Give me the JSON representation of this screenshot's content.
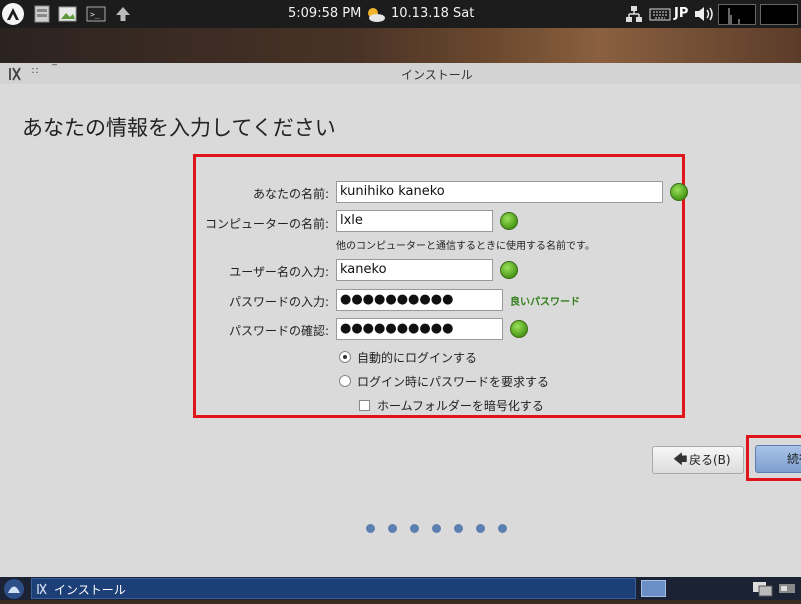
{
  "top_panel": {
    "clock": "5:09:58 PM",
    "date": "10.13.18 Sat",
    "keyboard_layout": "JP",
    "icons": [
      "lxle-menu-icon",
      "file-manager-icon",
      "image-viewer-icon",
      "terminal-icon",
      "updates-arrow-icon",
      "weather-icon",
      "network-icon",
      "keyboard-icon",
      "volume-icon",
      "cpu-graph-icon",
      "workspace-pager-icon"
    ]
  },
  "window": {
    "title": "インストール",
    "heading": "あなたの情報を入力してください"
  },
  "form": {
    "name_label": "あなたの名前:",
    "name_value": "kunihiko kaneko",
    "computer_label": "コンピューターの名前:",
    "computer_value": "lxle",
    "computer_hint": "他のコンピューターと通信するときに使用する名前です。",
    "username_label": "ユーザー名の入力:",
    "username_value": "kaneko",
    "password_label": "パスワードの入力:",
    "password_value": "●●●●●●●●●●",
    "password_strength": "良いパスワード",
    "confirm_label": "パスワードの確認:",
    "confirm_value": "●●●●●●●●●●",
    "auto_login_label": "自動的にログインする",
    "require_password_label": "ログイン時にパスワードを要求する",
    "encrypt_home_label": "ホームフォルダーを暗号化する",
    "auto_login_selected": true,
    "encrypt_home_checked": false
  },
  "buttons": {
    "back_label": "戻る(B)",
    "continue_label": "続行"
  },
  "progress": {
    "total_steps": 7
  },
  "colors": {
    "highlight": "#e0141b",
    "ok_green": "#4a9a18",
    "strength_text": "#2f7d18",
    "accent": "#5a7fb0"
  },
  "taskbar": {
    "task_label": "インストール"
  }
}
